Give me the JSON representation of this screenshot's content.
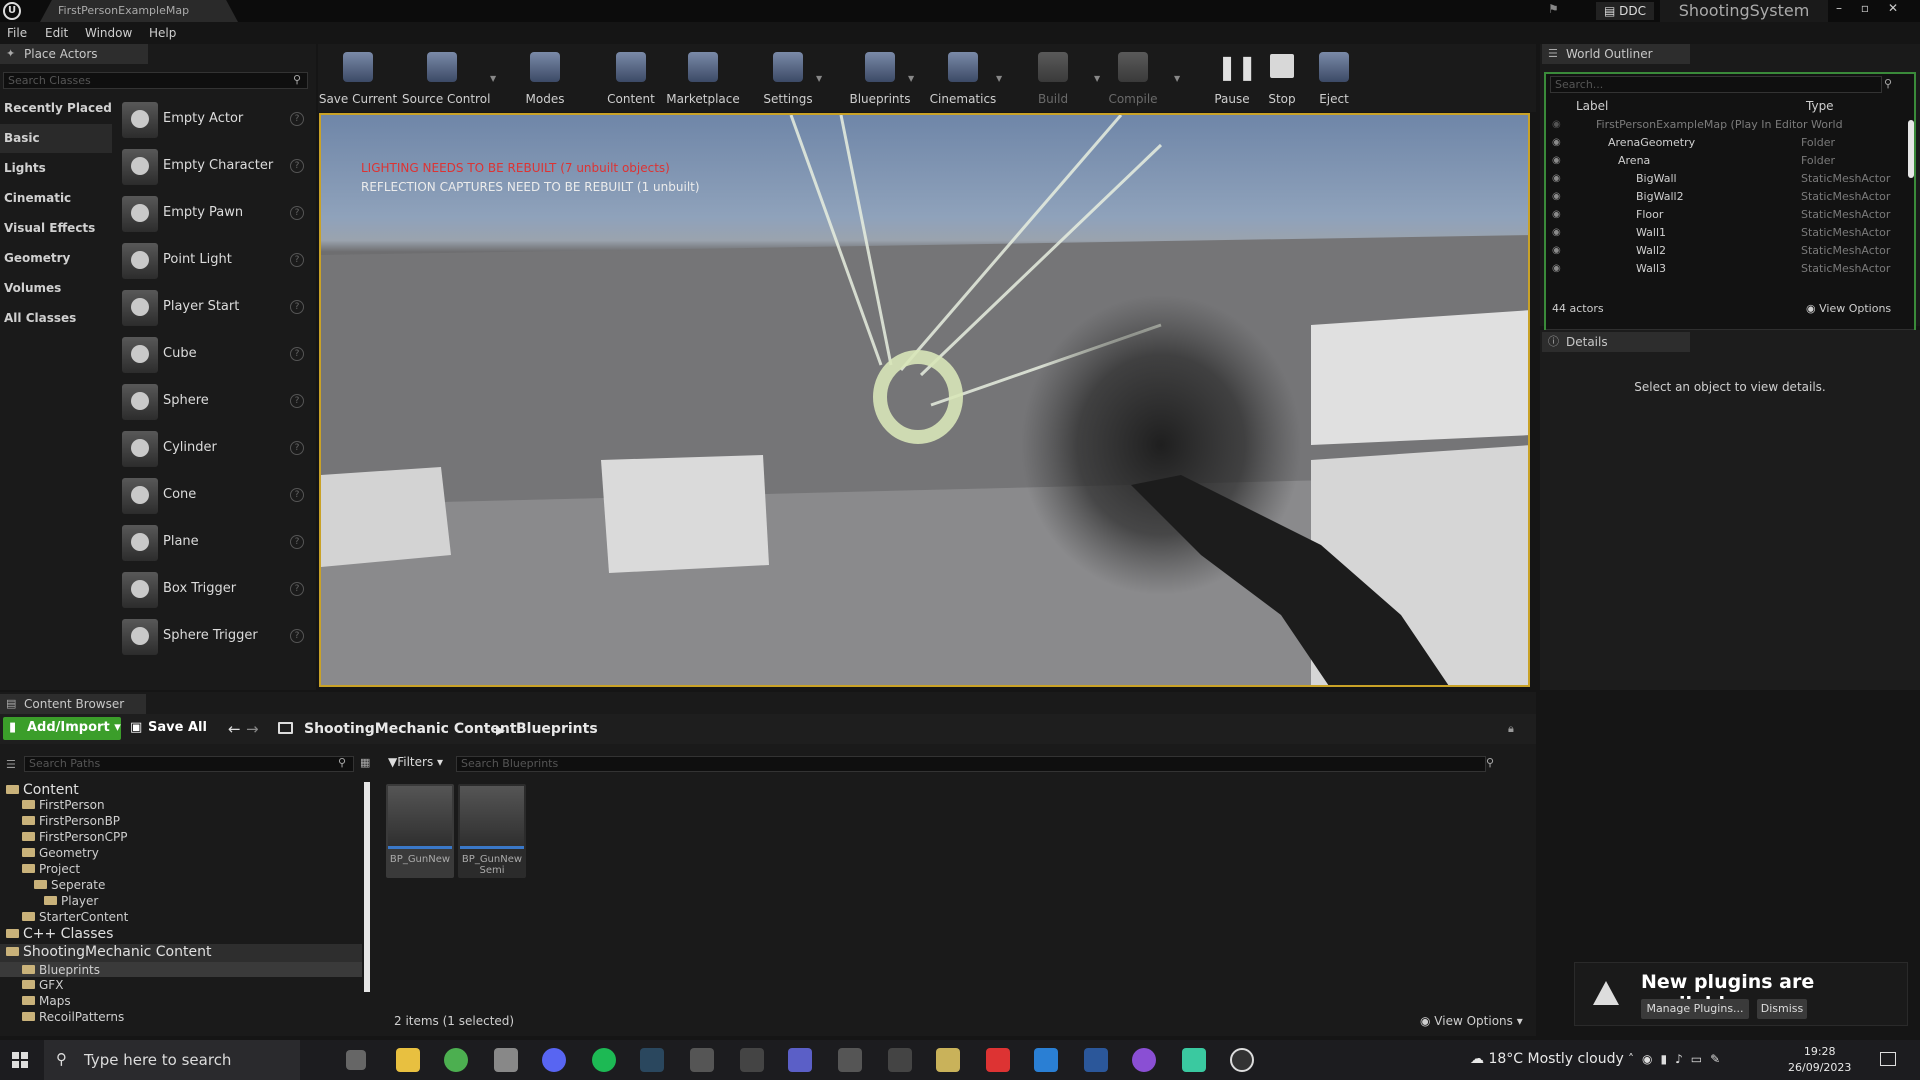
{
  "window": {
    "tab_title": "FirstPersonExampleMap",
    "ddc_label": "DDC",
    "project_name": "ShootingSystem"
  },
  "menu": [
    "File",
    "Edit",
    "Window",
    "Help"
  ],
  "place_actors": {
    "tab_label": "Place Actors",
    "search_placeholder": "Search Classes",
    "categories": [
      "Recently Placed",
      "Basic",
      "Lights",
      "Cinematic",
      "Visual Effects",
      "Geometry",
      "Volumes",
      "All Classes"
    ],
    "active_category": "Basic",
    "actors": [
      "Empty Actor",
      "Empty Character",
      "Empty Pawn",
      "Point Light",
      "Player Start",
      "Cube",
      "Sphere",
      "Cylinder",
      "Cone",
      "Plane",
      "Box Trigger",
      "Sphere Trigger"
    ]
  },
  "toolbar": {
    "buttons": [
      "Save Current",
      "Source Control",
      "Modes",
      "Content",
      "Marketplace",
      "Settings",
      "Blueprints",
      "Cinematics",
      "Build",
      "Compile",
      "Pause",
      "Stop",
      "Eject"
    ]
  },
  "viewport": {
    "lighting_warning": "LIGHTING NEEDS TO BE REBUILT (7 unbuilt objects)",
    "reflection_warning": "REFLECTION CAPTURES NEED TO BE REBUILT (1 unbuilt)"
  },
  "outliner": {
    "tab_label": "World Outliner",
    "search_placeholder": "Search...",
    "col_label": "Label",
    "col_type": "Type",
    "rows": [
      {
        "label": "FirstPersonExampleMap (Play In Editor World",
        "type": ""
      },
      {
        "label": "ArenaGeometry",
        "type": "Folder"
      },
      {
        "label": "Arena",
        "type": "Folder"
      },
      {
        "label": "BigWall",
        "type": "StaticMeshActor"
      },
      {
        "label": "BigWall2",
        "type": "StaticMeshActor"
      },
      {
        "label": "Floor",
        "type": "StaticMeshActor"
      },
      {
        "label": "Wall1",
        "type": "StaticMeshActor"
      },
      {
        "label": "Wall2",
        "type": "StaticMeshActor"
      },
      {
        "label": "Wall3",
        "type": "StaticMeshActor"
      }
    ],
    "actor_count": "44 actors",
    "view_options": "View Options"
  },
  "details": {
    "tab_label": "Details",
    "empty_text": "Select an object to view details."
  },
  "content_browser": {
    "tab_label": "Content Browser",
    "add_import": "Add/Import",
    "save_all": "Save All",
    "breadcrumb": [
      "ShootingMechanic Content",
      "Blueprints"
    ],
    "path_search_placeholder": "Search Paths",
    "filters_label": "Filters",
    "asset_search_placeholder": "Search Blueprints",
    "tree": [
      {
        "label": "Content",
        "big": true
      },
      {
        "label": "FirstPerson"
      },
      {
        "label": "FirstPersonBP"
      },
      {
        "label": "FirstPersonCPP"
      },
      {
        "label": "Geometry"
      },
      {
        "label": "Project"
      },
      {
        "label": "Seperate"
      },
      {
        "label": "Player"
      },
      {
        "label": "StarterContent"
      },
      {
        "label": "C++ Classes",
        "big": true
      },
      {
        "label": "ShootingMechanic Content",
        "big": true
      },
      {
        "label": "Blueprints"
      },
      {
        "label": "GFX"
      },
      {
        "label": "Maps"
      },
      {
        "label": "RecoilPatterns"
      }
    ],
    "assets": [
      {
        "name": "BP_GunNew"
      },
      {
        "name": "BP_GunNew Semi"
      }
    ],
    "status": "2 items (1 selected)",
    "view_options": "View Options"
  },
  "notification": {
    "title": "New plugins are available",
    "manage": "Manage Plugins...",
    "dismiss": "Dismiss"
  },
  "taskbar": {
    "search_placeholder": "Type here to search",
    "weather": "18°C  Mostly cloudy",
    "time": "19:28",
    "date": "26/09/2023"
  }
}
